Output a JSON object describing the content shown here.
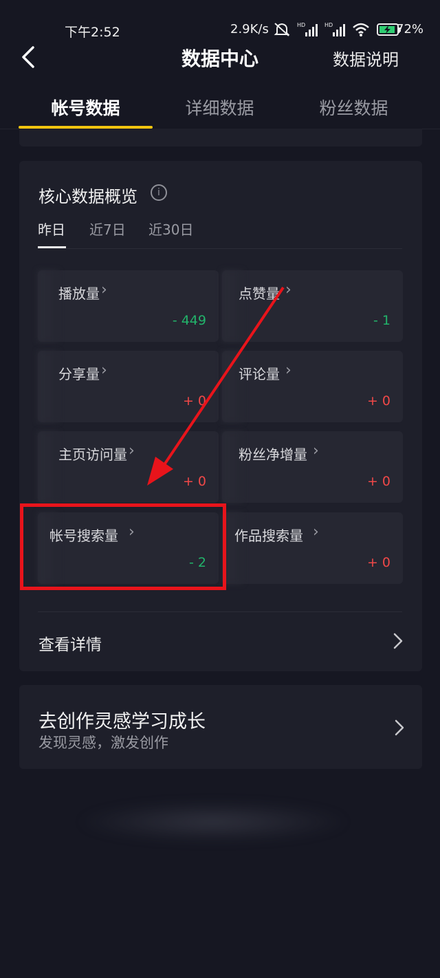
{
  "status_bar": {
    "time": "下午2:52",
    "network_speed": "2.9K/s",
    "battery": "72%",
    "icons": [
      "mute-icon",
      "hd-signal-icon",
      "hd-signal-icon",
      "wifi-icon",
      "battery-charging-icon"
    ]
  },
  "header": {
    "title": "数据中心",
    "right_link": "数据说明"
  },
  "tabs": [
    {
      "label": "帐号数据",
      "active": true
    },
    {
      "label": "详细数据",
      "active": false
    },
    {
      "label": "粉丝数据",
      "active": false
    }
  ],
  "overview": {
    "title": "核心数据概览",
    "ranges": [
      {
        "label": "昨日",
        "active": true
      },
      {
        "label": "近7日",
        "active": false
      },
      {
        "label": "近30日",
        "active": false
      }
    ],
    "metrics": [
      {
        "label": "播放量",
        "delta": "- 449"
      },
      {
        "label": "点赞量",
        "delta": "- 1"
      },
      {
        "label": "分享量",
        "delta": "+ 0"
      },
      {
        "label": "评论量",
        "delta": "+ 0"
      },
      {
        "label": "主页访问量",
        "delta": "+ 0"
      },
      {
        "label": "粉丝净增量",
        "delta": "+ 0"
      },
      {
        "label": "帐号搜索量",
        "delta": "- 2"
      },
      {
        "label": "作品搜索量",
        "delta": "+ 0"
      }
    ],
    "detail_link": "查看详情"
  },
  "inspiration": {
    "title": "去创作灵感学习成长",
    "subtitle": "发现灵感，激发创作"
  },
  "colors": {
    "background": "#161722",
    "card": "#1e1f2a",
    "tile": "#262732",
    "accent": "#f1c40f",
    "negative_delta": "#22b46b",
    "positive_delta": "#f04848",
    "annotation": "#e8141b"
  }
}
